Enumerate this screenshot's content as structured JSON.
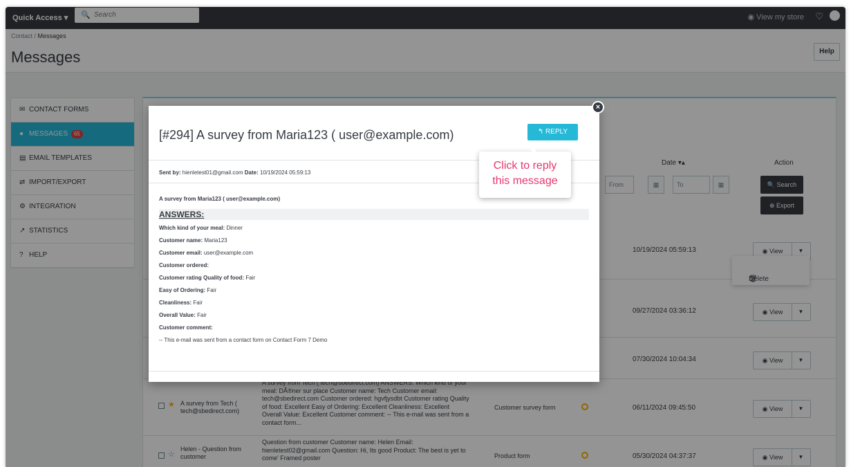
{
  "topbar": {
    "quick_access": "Quick Access ▾",
    "search_placeholder": "Search",
    "view_store": "View my store"
  },
  "header": {
    "breadcrumb_parent": "Contact",
    "breadcrumb_sep": " / ",
    "breadcrumb_current": "Messages",
    "title": "Messages",
    "help": "Help"
  },
  "sidebar": {
    "items": [
      {
        "label": "CONTACT FORMS",
        "icon": "✉"
      },
      {
        "label": "MESSAGES",
        "icon": "●",
        "badge": "65"
      },
      {
        "label": "EMAIL TEMPLATES",
        "icon": "▤"
      },
      {
        "label": "IMPORT/EXPORT",
        "icon": "⇄"
      },
      {
        "label": "INTEGRATION",
        "icon": "⚙"
      },
      {
        "label": "STATISTICS",
        "icon": "↗"
      },
      {
        "label": "HELP",
        "icon": "?"
      }
    ]
  },
  "table": {
    "date_header": "Date ▾▴",
    "action_header": "Action",
    "from_placeholder": "From",
    "to_placeholder": "To",
    "search_btn": "Search",
    "export_btn": "Export",
    "view_label": "View",
    "delete_label": "Delete",
    "rows": [
      {
        "date": "10/19/2024 05:59:13"
      },
      {
        "date": "09/27/2024 03:36:12"
      },
      {
        "date": "07/30/2024 10:04:34"
      },
      {
        "subject": "A survey from Tech ( tech@sbedirect.com)",
        "message": "A survey from Tech ( tech@sbedirect.com) ANSWERS: Which kind of your meal: DÃ®ner sur place Customer name: Tech Customer email: tech@sbedirect.com Customer ordered: hgvfjysdbt Customer rating Quality of food: Excellent Easy of Ordering: Excellent Cleanliness: Excellent Overall Value: Excellent Customer comment: -- This e-mail was sent from a contact form...",
        "form": "Customer survey form",
        "date": "06/11/2024 09:45:50",
        "starred": true
      },
      {
        "subject": "Helen - Question from customer",
        "message": "Question from customer Customer name: Helen Email: hienletest02@gmail.com Question:  Hi, Its good Product: The best is yet to come' Framed poster",
        "form": "Product form",
        "date": "05/30/2024 04:37:37",
        "starred": false
      }
    ]
  },
  "modal": {
    "title": "[#294] A survey from Maria123 ( user@example.com)",
    "reply": "REPLY",
    "sent_by_label": "Sent by:",
    "sent_by": "hienletest01@gmail.com",
    "date_label": "Date:",
    "date": "10/19/2024 05:59:13",
    "subject": "A survey from Maria123 ( user@example.com)",
    "answers_heading": "ANSWERS:",
    "fields": [
      {
        "label": "Which kind of your meal:",
        "value": "Dinner"
      },
      {
        "label": "Customer name:",
        "value": "Maria123"
      },
      {
        "label": "Customer email:",
        "value": "user@example.com"
      },
      {
        "label": "Customer ordered:",
        "value": ""
      },
      {
        "label": "Customer rating Quality of food:",
        "value": "Fair"
      },
      {
        "label": "Easy of Ordering:",
        "value": "Fair"
      },
      {
        "label": "Cleanliness:",
        "value": "Fair"
      },
      {
        "label": "Overall Value:",
        "value": "Fair"
      },
      {
        "label": "Customer comment:",
        "value": ""
      }
    ],
    "footer_note": "-- This e-mail was sent from a contact form on Contact Form 7 Demo"
  },
  "tooltip": {
    "line1": "Click to reply",
    "line2": "this message"
  },
  "colors": {
    "accent": "#25b9d7",
    "dark": "#363a41",
    "tooltip_text": "#e8356d",
    "badge": "#e23f3f"
  }
}
